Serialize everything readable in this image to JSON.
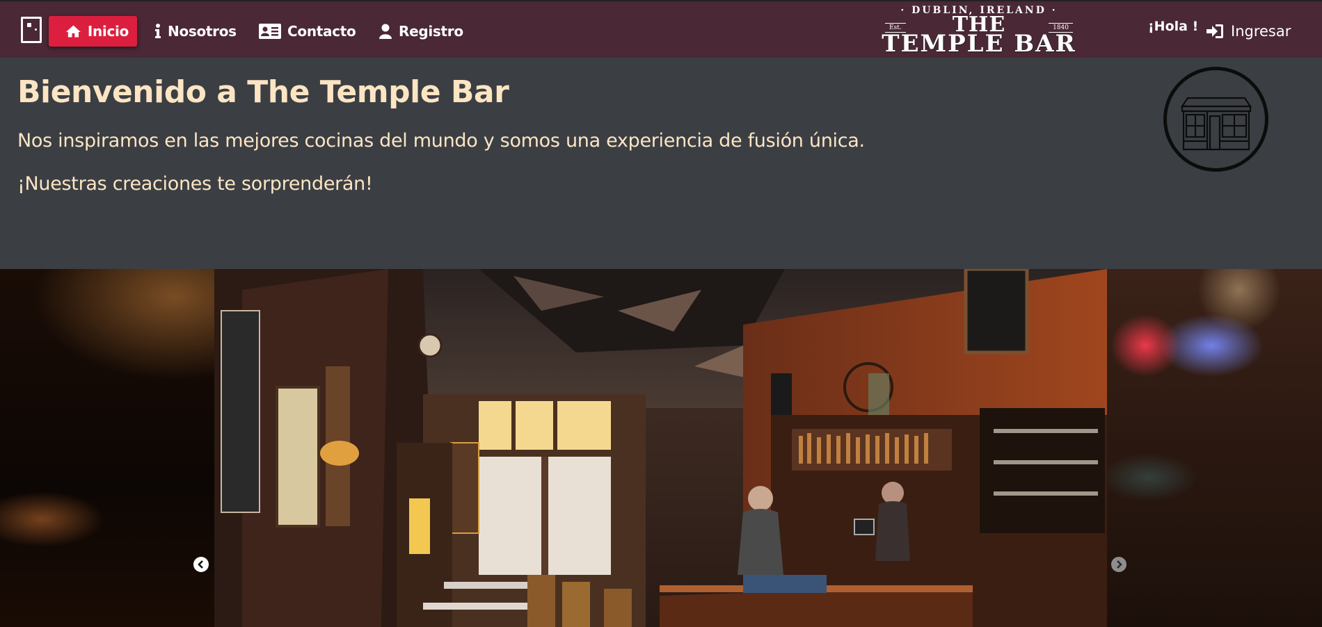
{
  "nav": {
    "items": [
      {
        "label": "Inicio",
        "icon": "home-icon",
        "active": true
      },
      {
        "label": "Nosotros",
        "icon": "info-icon"
      },
      {
        "label": "Contacto",
        "icon": "address-card-icon"
      },
      {
        "label": "Registro",
        "icon": "user-icon"
      }
    ],
    "greeting": "¡Hola !",
    "login_label": "Ingresar"
  },
  "logo": {
    "top": "· DUBLIN, IRELAND ·",
    "est": "Est.",
    "year": "1840",
    "the": "THE",
    "name": "TEMPLE BAR"
  },
  "hero": {
    "title": "Bienvenido a The Temple Bar",
    "subtitle": "Nos inspiramos en las mejores cocinas del mundo y somos una experiencia de fusión única.",
    "tagline": "¡Nuestras creaciones te sorprenderán!"
  },
  "colors": {
    "navbar": "#4a2835",
    "active": "#dc1f3f",
    "hero_bg": "#3b3f43",
    "hero_text": "#fde5c4"
  }
}
